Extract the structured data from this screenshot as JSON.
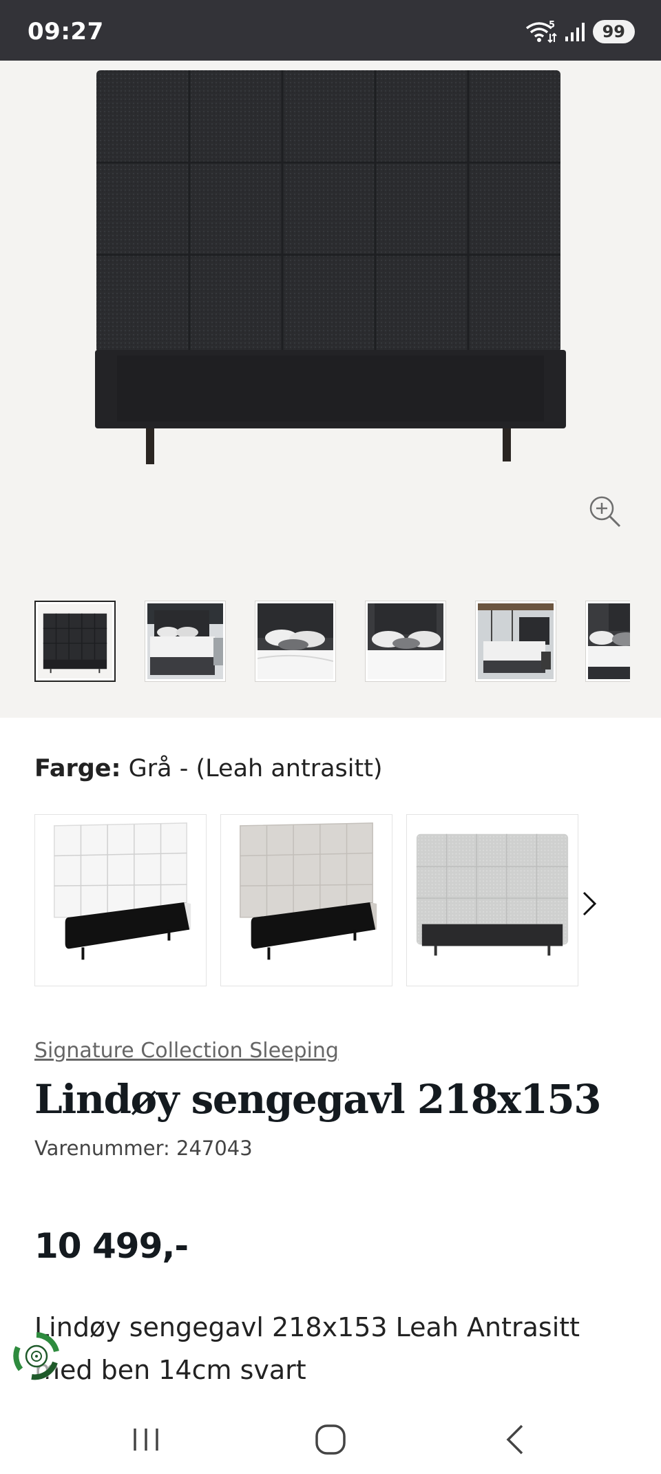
{
  "status_bar": {
    "time": "09:27",
    "wifi_badge": "5",
    "battery": "99",
    "icons": [
      "wifi-icon",
      "signal-icon",
      "battery-icon"
    ]
  },
  "gallery": {
    "thumbnail_count": 6,
    "active_thumbnail": 1,
    "zoom_icon": "zoom-in-icon"
  },
  "color": {
    "label": "Farge:",
    "value": "Grå - (Leah antrasitt)",
    "swatch_names": [
      "white-headboard",
      "beige-headboard",
      "light-grey-headboard"
    ]
  },
  "product": {
    "brand": "Signature Collection Sleeping",
    "title": "Lindøy sengegavl 218x153",
    "sku": "Varenummer: 247043",
    "price": "10 499,-",
    "description": "Lindøy sengegavl 218x153 Leah Antrasitt med ben 14cm svart"
  },
  "colors": {
    "status_bar_bg": "#333338",
    "gallery_bg": "#f4f3f1",
    "headboard_dark": "#2a2b2e",
    "text_dark": "#141a1f",
    "badge_green": "#2e8b3e"
  }
}
